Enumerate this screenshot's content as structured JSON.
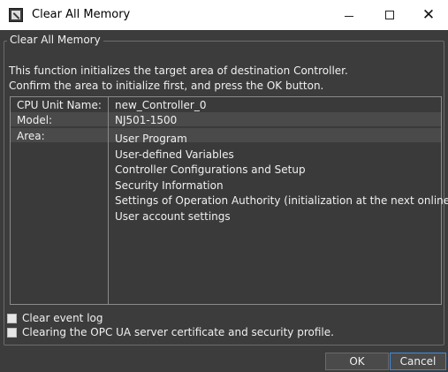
{
  "window": {
    "title": "Clear All Memory"
  },
  "group": {
    "title": "Clear All Memory",
    "description_line1": "This function initializes the target area of destination Controller.",
    "description_line2": "Confirm the area to initialize first, and press the OK button."
  },
  "info": {
    "cpu_label": "CPU Unit Name:",
    "cpu_value": "new_Controller_0",
    "model_label": "Model:",
    "model_value": "NJ501-1500",
    "area_label": "Area:",
    "areas": [
      "User Program",
      "User-defined Variables",
      "Controller Configurations and Setup",
      "Security Information",
      "Settings of Operation Authority (initialization at the next online)",
      "User account settings"
    ]
  },
  "options": {
    "clear_event_log": "Clear event log",
    "clear_opcua": "Clearing the OPC UA server certificate and security profile."
  },
  "buttons": {
    "ok": "OK",
    "cancel": "Cancel"
  },
  "colors": {
    "background": "#3c3c3c",
    "panel": "#3a3a3a",
    "row_highlight": "#4a4a4a",
    "text": "#f0f0f0",
    "focus_border": "#3d8ee0"
  }
}
